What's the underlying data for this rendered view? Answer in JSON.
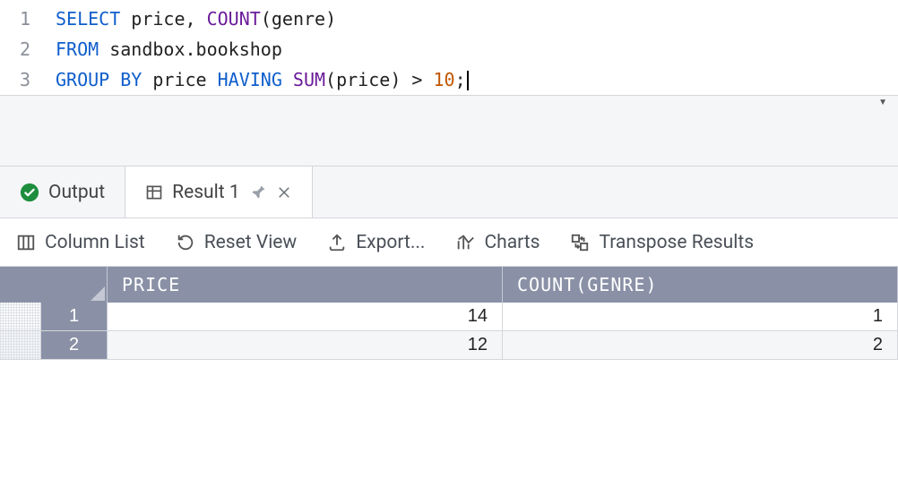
{
  "editor": {
    "lines": [
      {
        "num": "1",
        "tokens": [
          {
            "cls": "kw",
            "t": "SELECT"
          },
          {
            "cls": "ident",
            "t": " price"
          },
          {
            "cls": "punct",
            "t": ", "
          },
          {
            "cls": "fn",
            "t": "COUNT"
          },
          {
            "cls": "punct",
            "t": "("
          },
          {
            "cls": "ident",
            "t": "genre"
          },
          {
            "cls": "punct",
            "t": ")"
          }
        ]
      },
      {
        "num": "2",
        "tokens": [
          {
            "cls": "kw",
            "t": "FROM"
          },
          {
            "cls": "ident",
            "t": " sandbox.bookshop"
          }
        ]
      },
      {
        "num": "3",
        "tokens": [
          {
            "cls": "kw",
            "t": "GROUP BY"
          },
          {
            "cls": "ident",
            "t": " price "
          },
          {
            "cls": "kw",
            "t": "HAVING"
          },
          {
            "cls": "ident",
            "t": " "
          },
          {
            "cls": "fn",
            "t": "SUM"
          },
          {
            "cls": "punct",
            "t": "("
          },
          {
            "cls": "ident",
            "t": "price"
          },
          {
            "cls": "punct",
            "t": ")"
          },
          {
            "cls": "ident",
            "t": " "
          },
          {
            "cls": "op",
            "t": ">"
          },
          {
            "cls": "ident",
            "t": " "
          },
          {
            "cls": "num",
            "t": "10"
          },
          {
            "cls": "punct",
            "t": ";"
          }
        ],
        "cursor": true
      }
    ]
  },
  "tabs": {
    "output_label": "Output",
    "result_label": "Result 1"
  },
  "toolbar": {
    "column_list": "Column List",
    "reset_view": "Reset View",
    "export": "Export...",
    "charts": "Charts",
    "transpose": "Transpose Results"
  },
  "grid": {
    "columns": [
      "PRICE",
      "COUNT(GENRE)"
    ],
    "rows": [
      {
        "n": "1",
        "cells": [
          "14",
          "1"
        ]
      },
      {
        "n": "2",
        "cells": [
          "12",
          "2"
        ]
      }
    ]
  }
}
